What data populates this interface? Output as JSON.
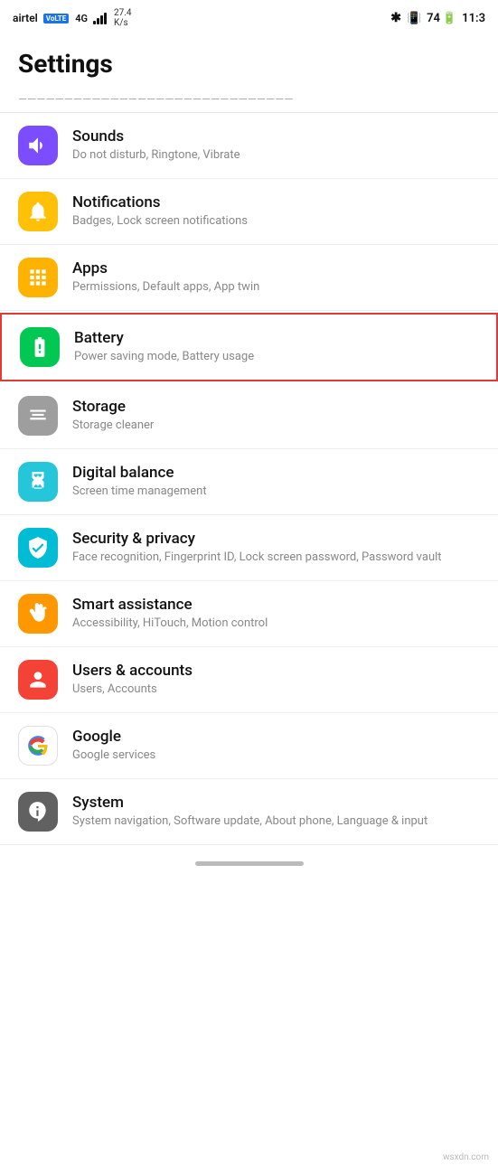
{
  "statusBar": {
    "carrier": "airtel",
    "volte": "VoLTE",
    "speed": "27.4\nK/s",
    "time": "11:3",
    "batteryLevel": 74
  },
  "pageTitle": "Settings",
  "partialItem": {
    "text": "...g...y...p..."
  },
  "settingsItems": [
    {
      "id": "sounds",
      "title": "Sounds",
      "subtitle": "Do not disturb, Ringtone, Vibrate",
      "iconColor": "bg-purple",
      "iconType": "sound"
    },
    {
      "id": "notifications",
      "title": "Notifications",
      "subtitle": "Badges, Lock screen notifications",
      "iconColor": "bg-yellow",
      "iconType": "bell"
    },
    {
      "id": "apps",
      "title": "Apps",
      "subtitle": "Permissions, Default apps, App twin",
      "iconColor": "bg-yellow-apps",
      "iconType": "apps"
    },
    {
      "id": "battery",
      "title": "Battery",
      "subtitle": "Power saving mode, Battery usage",
      "iconColor": "bg-green",
      "iconType": "battery",
      "highlighted": true
    },
    {
      "id": "storage",
      "title": "Storage",
      "subtitle": "Storage cleaner",
      "iconColor": "bg-gray",
      "iconType": "storage"
    },
    {
      "id": "digital-balance",
      "title": "Digital balance",
      "subtitle": "Screen time management",
      "iconColor": "bg-teal",
      "iconType": "hourglass"
    },
    {
      "id": "security-privacy",
      "title": "Security & privacy",
      "subtitle": "Face recognition, Fingerprint ID, Lock screen password, Password vault",
      "iconColor": "bg-cyan",
      "iconType": "shield"
    },
    {
      "id": "smart-assistance",
      "title": "Smart assistance",
      "subtitle": "Accessibility, HiTouch, Motion control",
      "iconColor": "bg-orange",
      "iconType": "hand"
    },
    {
      "id": "users-accounts",
      "title": "Users & accounts",
      "subtitle": "Users, Accounts",
      "iconColor": "bg-red",
      "iconType": "user"
    },
    {
      "id": "google",
      "title": "Google",
      "subtitle": "Google services",
      "iconColor": "bg-google",
      "iconType": "google"
    },
    {
      "id": "system",
      "title": "System",
      "subtitle": "System navigation, Software update, About phone, Language & input",
      "iconColor": "bg-dark-gray",
      "iconType": "info"
    }
  ],
  "watermark": "wsxdn.com"
}
